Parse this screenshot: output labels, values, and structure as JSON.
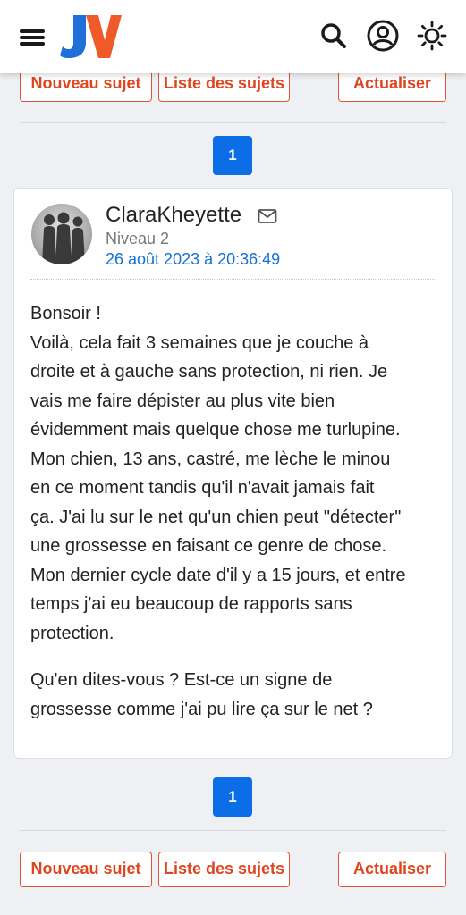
{
  "header": {
    "menu_icon": "hamburger-menu-icon",
    "logo_text": "JV",
    "search_icon": "search-icon",
    "account_icon": "user-account-icon",
    "theme_icon": "sun-icon"
  },
  "top_actions": {
    "new_topic": "Nouveau sujet",
    "topic_list": "Liste des sujets",
    "refresh": "Actualiser"
  },
  "pagination": {
    "current_page": "1"
  },
  "post": {
    "author": "ClaraKheyette",
    "level": "Niveau 2",
    "date": "26 août 2023 à 20:36:49",
    "paragraph1": [
      "Bonsoir !",
      "Voilà, cela fait 3 semaines que je couche à",
      "droite et à gauche sans protection, ni rien. Je",
      "vais me faire dépister au plus vite bien",
      "évidemment mais quelque chose me turlupine.",
      "Mon chien, 13 ans, castré, me lèche le minou",
      "en ce moment tandis qu'il n'avait jamais fait",
      "ça. J'ai lu sur le net qu'un chien peut \"détecter\"",
      "une grossesse en faisant ce genre de chose.",
      "Mon dernier cycle date d'il y a 15 jours, et entre",
      "temps j'ai eu beaucoup de rapports sans",
      "protection."
    ],
    "paragraph2": [
      "Qu'en dites-vous ? Est-ce un signe de",
      "grossesse comme j'ai pu lire ça sur le net ?"
    ]
  },
  "bottom_actions": {
    "new_topic": "Nouveau sujet",
    "topic_list": "Liste des sujets",
    "refresh": "Actualiser"
  },
  "colors": {
    "accent": "#e0451f",
    "pager": "#0b6ee6",
    "date_link": "#1570d6",
    "logo_j": "#1e6fd9",
    "logo_v": "#f05a28"
  }
}
